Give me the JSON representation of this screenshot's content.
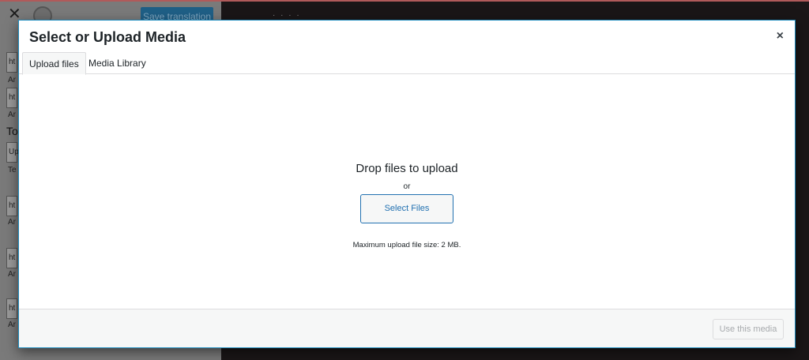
{
  "background": {
    "close_glyph": "✕",
    "save_label": "Save translation",
    "stars": "· · · ·",
    "field_values": [
      "ht",
      "ht",
      "Up",
      "ht",
      "ht",
      "ht"
    ],
    "field_captions": [
      "Ar",
      "Ar",
      "Te",
      "Ar",
      "Ar",
      "Ar"
    ],
    "heading": "To"
  },
  "modal": {
    "title": "Select or Upload Media",
    "close_glyph": "×",
    "tabs": [
      {
        "label": "Upload files",
        "active": true
      },
      {
        "label": "Media Library",
        "active": false
      }
    ],
    "upload": {
      "drop_text": "Drop files to upload",
      "or_text": "or",
      "select_button": "Select Files",
      "max_size_text": "Maximum upload file size: 2 MB."
    },
    "footer": {
      "use_button": "Use this media",
      "use_button_disabled": true
    }
  },
  "colors": {
    "accent": "#2271b1",
    "modal_border": "#1e8cbe",
    "overlay": "#1a1617"
  }
}
